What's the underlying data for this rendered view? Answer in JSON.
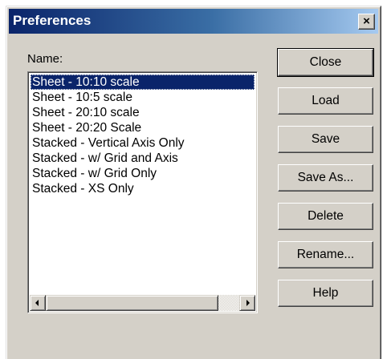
{
  "window": {
    "title": "Preferences",
    "close_label": "×"
  },
  "name_label": "Name:",
  "list": {
    "items": [
      "Sheet - 10:10 scale",
      "Sheet - 10:5 scale",
      "Sheet - 20:10 scale",
      "Sheet - 20:20 Scale",
      "Stacked - Vertical Axis Only",
      "Stacked - w/ Grid and Axis",
      "Stacked - w/ Grid Only",
      "Stacked - XS Only"
    ],
    "selected_index": 0
  },
  "buttons": {
    "close": "Close",
    "load": "Load",
    "save": "Save",
    "save_as": "Save As...",
    "delete": "Delete",
    "rename": "Rename...",
    "help": "Help"
  },
  "colors": {
    "selection": "#0a246a",
    "titlebar_start": "#0a246a",
    "titlebar_end": "#a6caf0",
    "face": "#d4d0c8"
  },
  "icons": {
    "close": "close-icon",
    "scroll_left": "arrow-left-icon",
    "scroll_right": "arrow-right-icon"
  }
}
